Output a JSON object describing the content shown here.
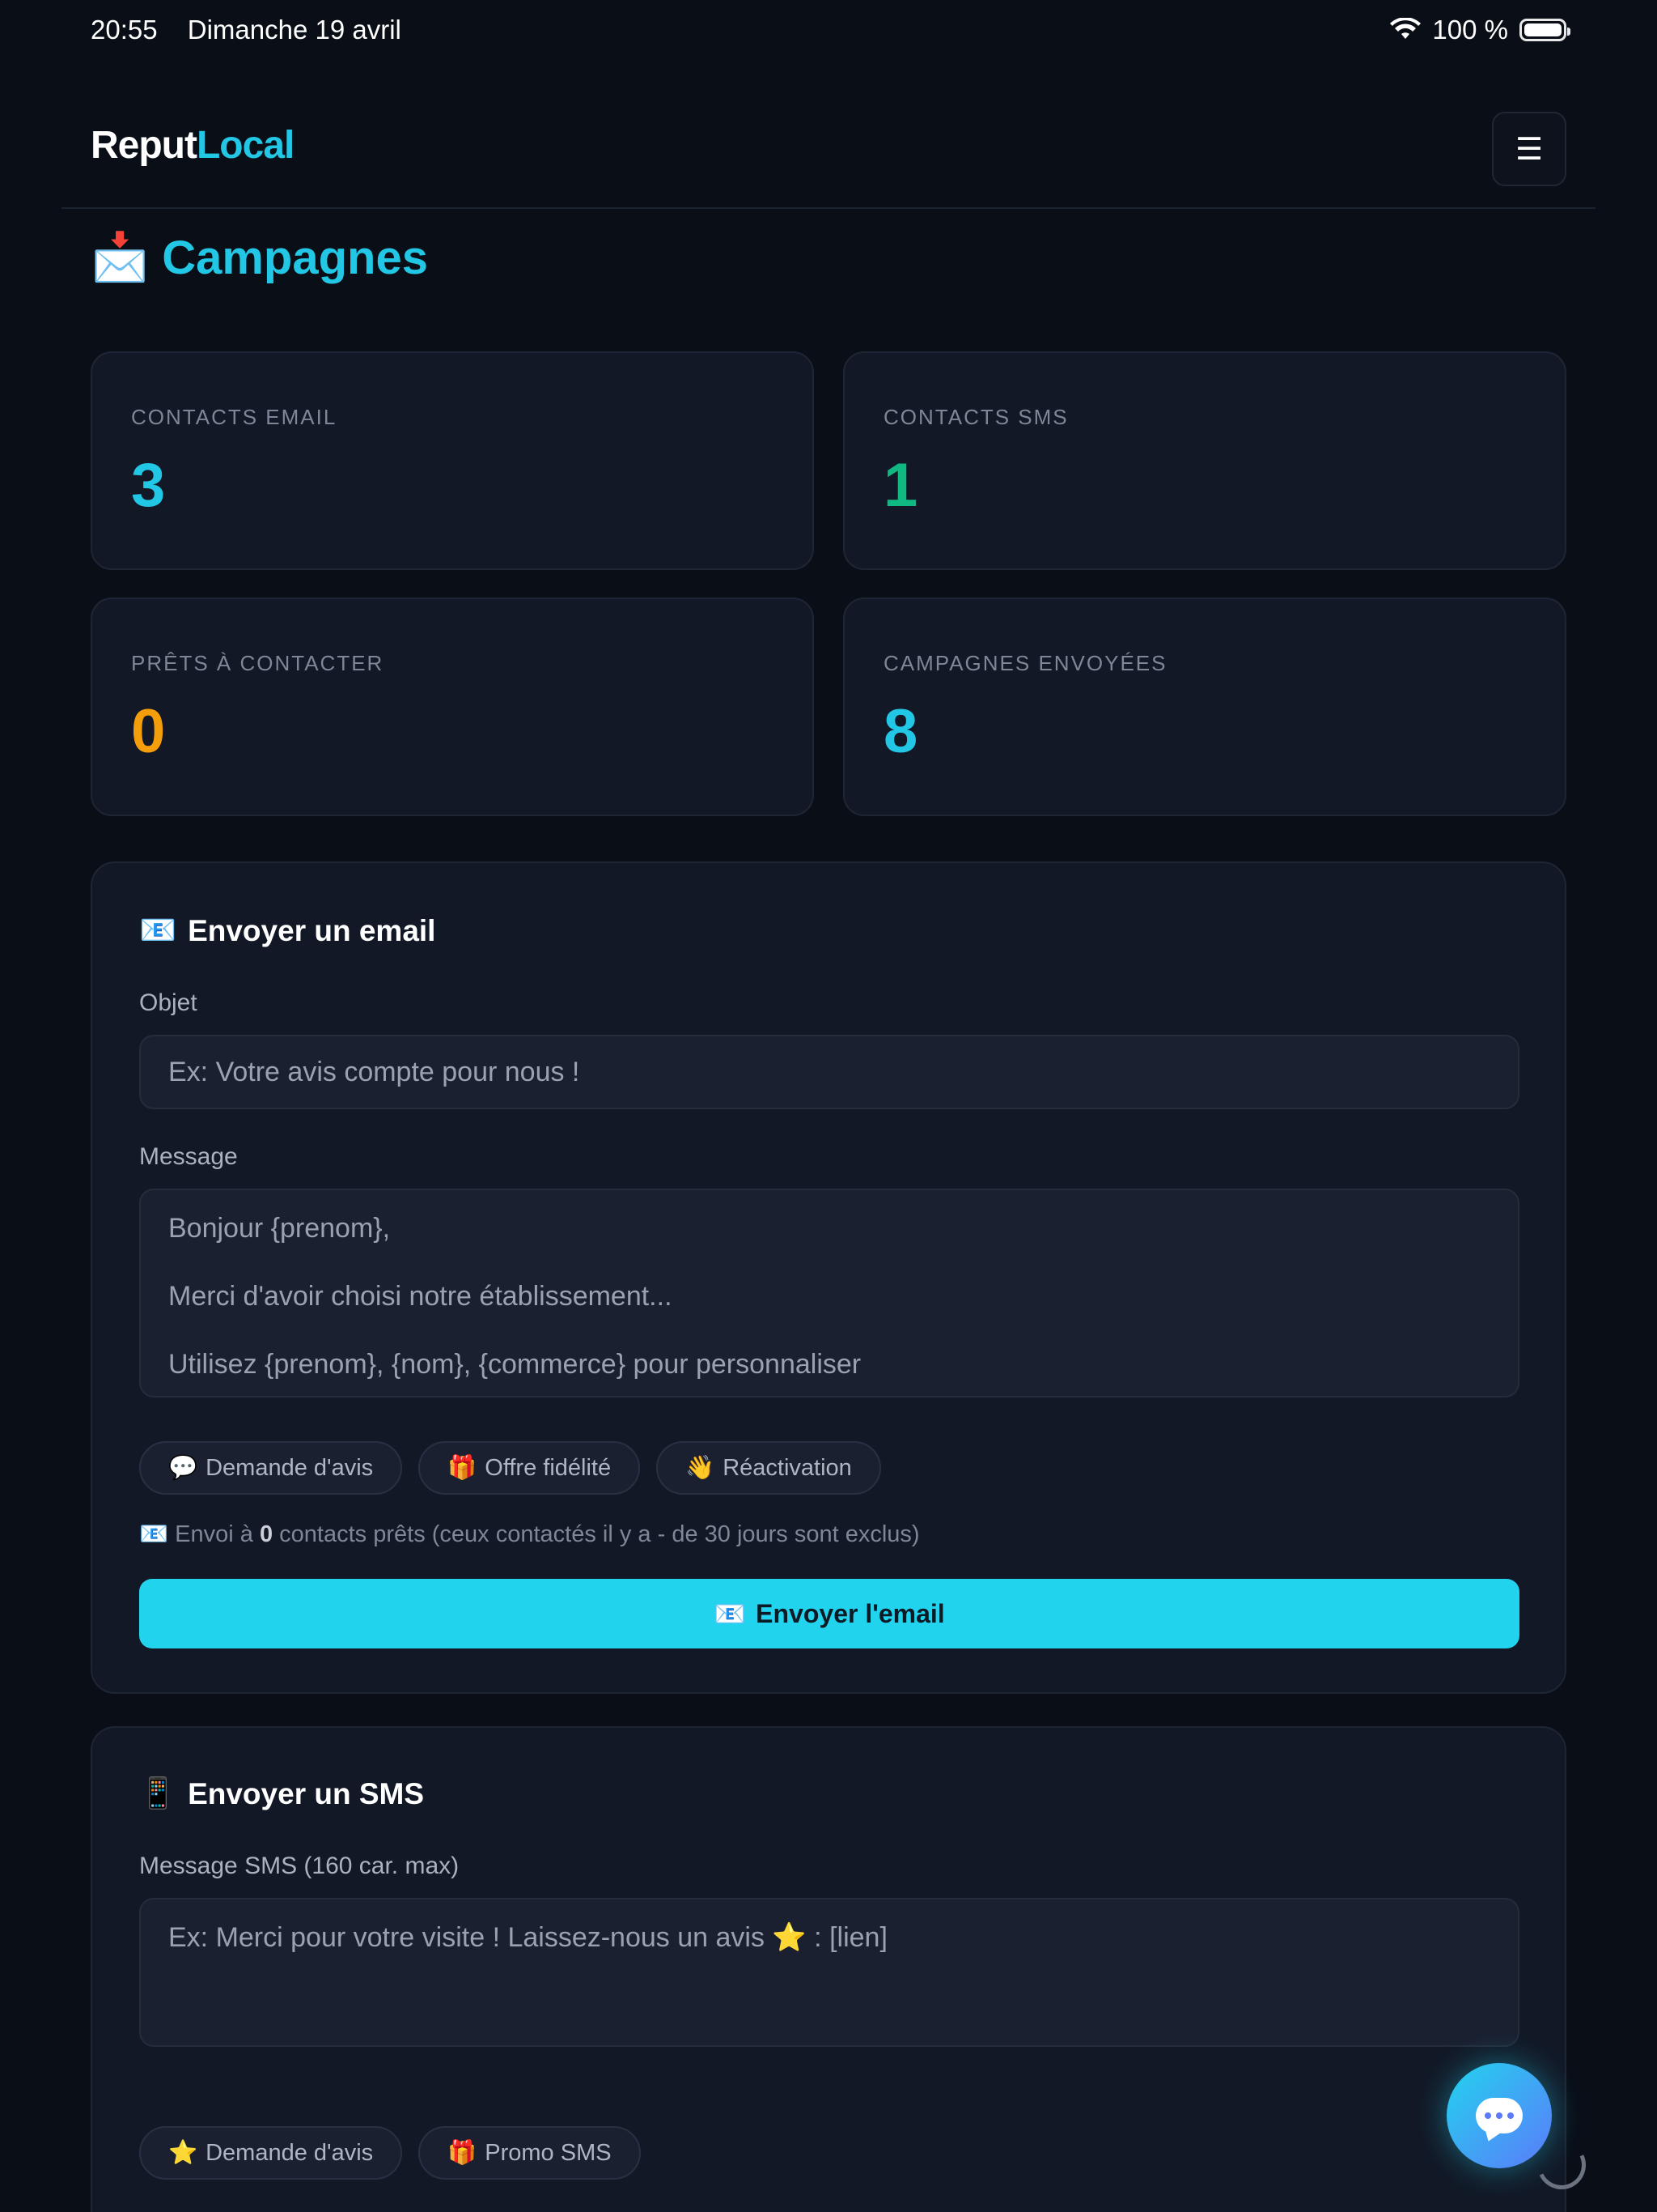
{
  "status_bar": {
    "time": "20:55",
    "date": "Dimanche 19 avril",
    "battery": "100 %"
  },
  "header": {
    "logo_part1": "Reput",
    "logo_part2": "Local",
    "menu_icon": "☰"
  },
  "page": {
    "title_icon": "📩",
    "title": "Campagnes"
  },
  "stats": [
    {
      "label": "CONTACTS EMAIL",
      "value": "3",
      "color": "#22c7e5"
    },
    {
      "label": "CONTACTS SMS",
      "value": "1",
      "color": "#10b981"
    },
    {
      "label": "PRÊTS À CONTACTER",
      "value": "0",
      "color": "#f59e0b"
    },
    {
      "label": "CAMPAGNES ENVOYÉES",
      "value": "8",
      "color": "#22c7e5"
    }
  ],
  "email": {
    "title_icon": "📧",
    "title": "Envoyer un email",
    "subject_label": "Objet",
    "subject_placeholder": "Ex: Votre avis compte pour nous !",
    "message_label": "Message",
    "message_placeholder_lines": [
      "Bonjour {prenom},",
      "Merci d'avoir choisi notre établissement...",
      "Utilisez {prenom}, {nom}, {commerce} pour personnaliser"
    ],
    "templates": [
      {
        "icon": "💬",
        "label": "Demande d'avis"
      },
      {
        "icon": "🎁",
        "label": "Offre fidélité"
      },
      {
        "icon": "👋",
        "label": "Réactivation"
      }
    ],
    "note_icon": "📧",
    "note_prefix": "Envoi à",
    "note_count": "0",
    "note_suffix": "contacts prêts (ceux contactés il y a - de 30 jours sont exclus)",
    "send_icon": "📧",
    "send_label": "Envoyer l'email"
  },
  "sms": {
    "title_icon": "📱",
    "title": "Envoyer un SMS",
    "message_label": "Message SMS (160 car. max)",
    "message_placeholder": "Ex: Merci pour votre visite ! Laissez-nous un avis ⭐ : [lien]",
    "templates": [
      {
        "icon": "⭐",
        "label": "Demande d'avis"
      },
      {
        "icon": "🎁",
        "label": "Promo SMS"
      }
    ]
  }
}
